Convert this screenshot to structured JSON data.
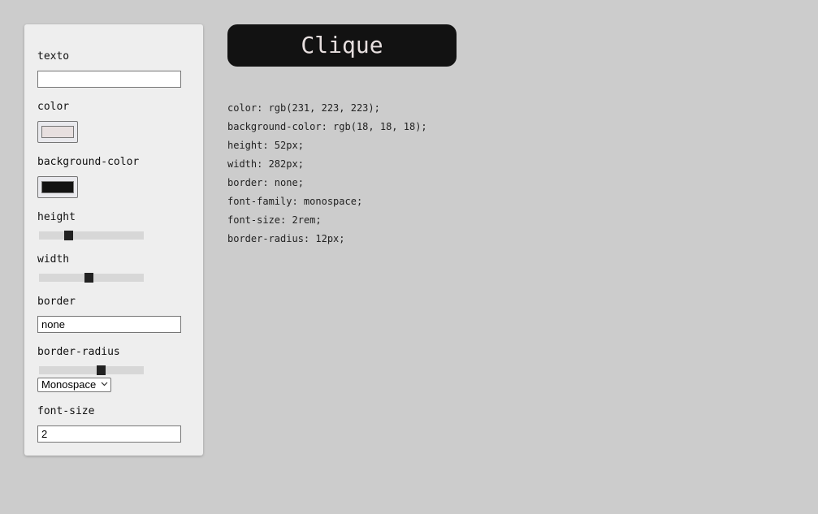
{
  "controls": {
    "texto": {
      "label": "texto",
      "value": ""
    },
    "color": {
      "label": "color",
      "value": "#e7dfdf"
    },
    "background_color": {
      "label": "background-color",
      "value": "#121212"
    },
    "height": {
      "label": "height",
      "fraction": 0.28
    },
    "width": {
      "label": "width",
      "fraction": 0.47
    },
    "border": {
      "label": "border",
      "value": "none"
    },
    "border_radius": {
      "label": "border-radius",
      "fraction": 0.59
    },
    "font_family": {
      "selected": "Monospace"
    },
    "font_size": {
      "label": "font-size",
      "value": "2"
    }
  },
  "preview": {
    "label": "Clique",
    "color": "#e7dfdf",
    "background": "#121212"
  },
  "css_output": [
    "color: rgb(231, 223, 223);",
    "background-color: rgb(18, 18, 18);",
    "height: 52px;",
    "width: 282px;",
    "border: none;",
    "font-family: monospace;",
    "font-size: 2rem;",
    "border-radius: 12px;"
  ]
}
